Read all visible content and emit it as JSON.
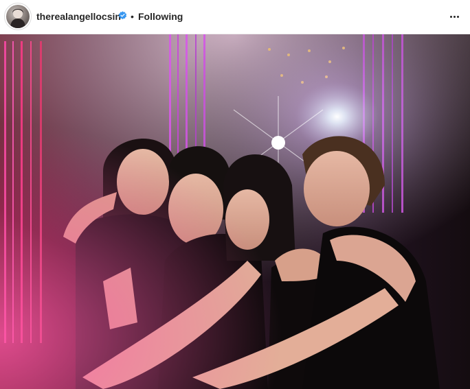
{
  "post": {
    "username": "therealangellocsin",
    "separator": "•",
    "follow_status": "Following",
    "verified": true
  },
  "icons": {
    "avatar": "profile-avatar",
    "verified": "verified-badge-icon",
    "more": "more-options-icon"
  },
  "colors": {
    "verified_blue": "#3897f0",
    "text": "#262626",
    "neon_pink": "#d24bd8",
    "neon_red": "#e0304a"
  },
  "photo": {
    "subject": "four women laughing at a night club"
  }
}
